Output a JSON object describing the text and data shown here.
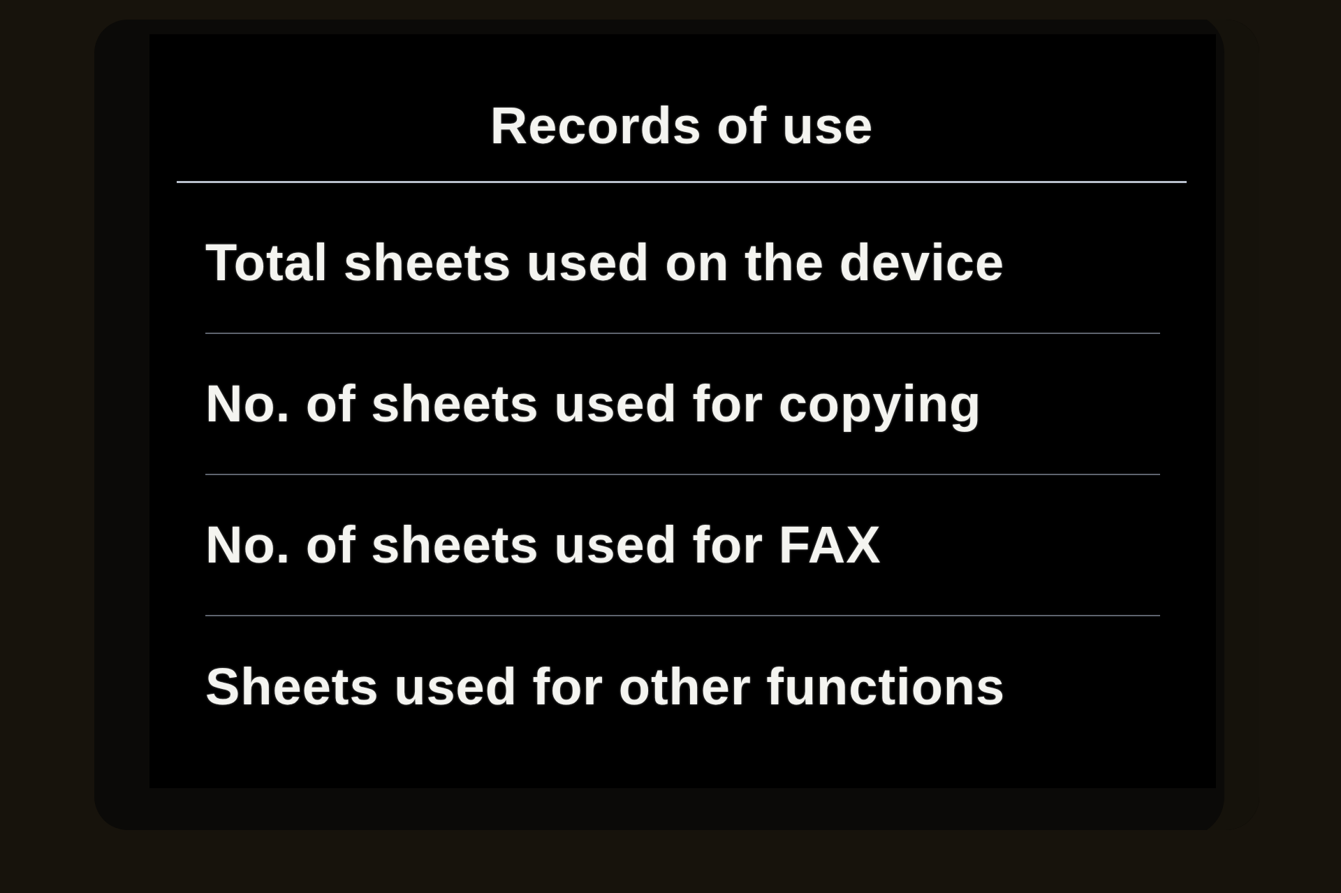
{
  "screen": {
    "title": "Records of use",
    "items": [
      {
        "label": "Total sheets used on the device"
      },
      {
        "label": "No. of sheets used for copying"
      },
      {
        "label": "No. of sheets used for FAX"
      },
      {
        "label": "Sheets used for other functions"
      }
    ]
  }
}
